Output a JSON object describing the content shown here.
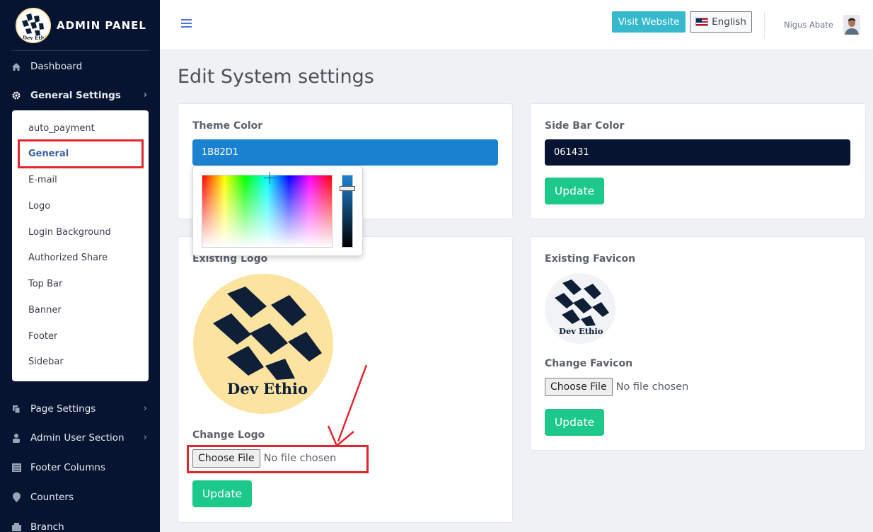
{
  "brand": {
    "title": "ADMIN PANEL",
    "logo_text": "Dev Ethio"
  },
  "sidebar": {
    "items": [
      {
        "label": "Dashboard",
        "icon": "home-icon"
      },
      {
        "label": "General Settings",
        "icon": "gear-icon"
      },
      {
        "label": "Page Settings",
        "icon": "copy-icon"
      },
      {
        "label": "Admin User Section",
        "icon": "user-icon"
      },
      {
        "label": "Footer Columns",
        "icon": "list-icon"
      },
      {
        "label": "Counters",
        "icon": "pin-icon"
      },
      {
        "label": "Branch",
        "icon": "branch-icon"
      }
    ],
    "submenu": [
      "auto_payment",
      "General",
      "E-mail",
      "Logo",
      "Login Background",
      "Authorized Share",
      "Top Bar",
      "Banner",
      "Footer",
      "Sidebar"
    ],
    "active_submenu": "General"
  },
  "topbar": {
    "visit_label": "Visit Website",
    "language_label": "English",
    "user_name": "Nigus Abate"
  },
  "page": {
    "title": "Edit System settings"
  },
  "theme": {
    "label": "Theme Color",
    "value": "1B82D1",
    "color": "#1B82D1"
  },
  "sidebar_color": {
    "label": "Side Bar Color",
    "value": "061431",
    "color": "#061431",
    "update_label": "Update"
  },
  "logo": {
    "existing_label": "Existing Logo",
    "change_label": "Change Logo",
    "choose_label": "Choose File",
    "no_file": "No file chosen",
    "update_label": "Update"
  },
  "favicon": {
    "existing_label": "Existing Favicon",
    "change_label": "Change Favicon",
    "choose_label": "Choose File",
    "no_file": "No file chosen",
    "update_label": "Update"
  },
  "colors": {
    "sidebar_bg": "#061431",
    "success": "#1cc88a",
    "info": "#36b9cc",
    "highlight": "#e0262e"
  }
}
